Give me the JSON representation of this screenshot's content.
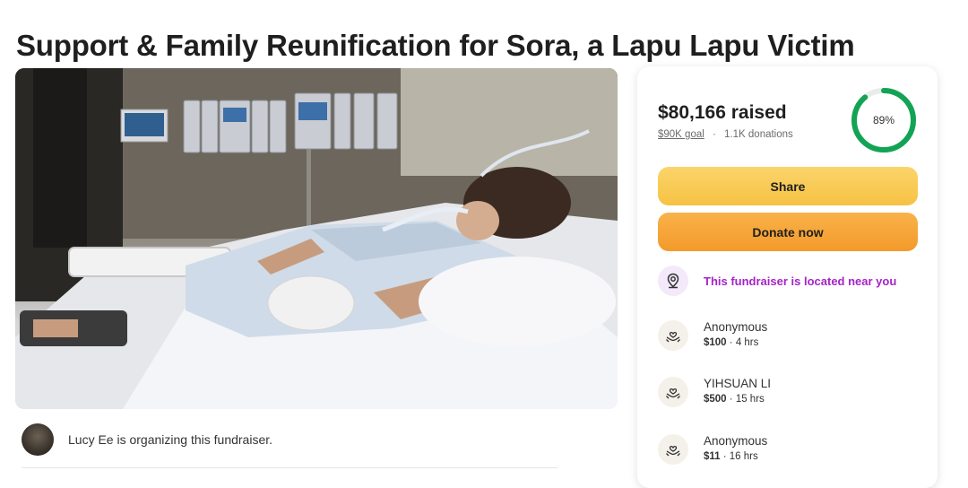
{
  "page": {
    "title": "Support & Family Reunification for Sora, a Lapu Lapu Victim"
  },
  "organizer": {
    "text": "Lucy Ee is organizing this fundraiser."
  },
  "donation_card": {
    "raised": "$80,166 raised",
    "goal": "$90K goal",
    "separator": "·",
    "donations_count": "1.1K donations",
    "progress_label": "89%",
    "progress_fraction": 0.89,
    "share_label": "Share",
    "donate_label": "Donate now",
    "nearby_text": "This fundraiser is located near you",
    "colors": {
      "progress": "#12a454",
      "share": "#f6c244",
      "donate": "#f39a2a",
      "nearby": "#a623c9"
    }
  },
  "donations": [
    {
      "name": "Anonymous",
      "amount": "$100",
      "time": "· 4 hrs",
      "icon": "heart-hands-icon"
    },
    {
      "name": "YIHSUAN LI",
      "amount": "$500",
      "time": "· 15 hrs",
      "icon": "heart-hands-icon"
    },
    {
      "name": "Anonymous",
      "amount": "$11",
      "time": "· 16 hrs",
      "icon": "heart-hands-icon"
    }
  ]
}
